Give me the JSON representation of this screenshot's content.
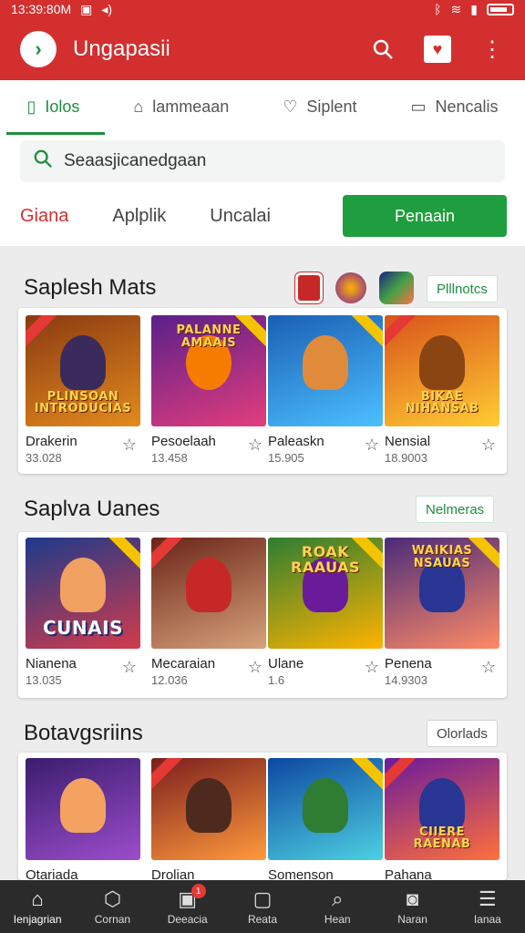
{
  "status": {
    "time": "13:39:80M",
    "left_icons": [
      "gallery-icon",
      "sound-icon"
    ],
    "right_icons": [
      "bluetooth-icon",
      "wifi-icon",
      "signal-icon",
      "battery-icon"
    ]
  },
  "appbar": {
    "title": "Ungapasii",
    "logo_glyph": "›"
  },
  "tabs": [
    {
      "label": "Iolos",
      "icon": "phone-icon",
      "glyph": "▯"
    },
    {
      "label": "lammeaan",
      "icon": "bag-icon",
      "glyph": "⌂"
    },
    {
      "label": "Siplent",
      "icon": "heart-icon",
      "glyph": "♡"
    },
    {
      "label": "Nencalis",
      "icon": "wallet-icon",
      "glyph": "▭"
    }
  ],
  "search": {
    "placeholder": "Seaasjicanedgaan"
  },
  "filters": {
    "chips": [
      "Giana",
      "Aplplik",
      "Uncalai"
    ],
    "primary_button": "Penaain"
  },
  "sections": [
    {
      "title": "Saplesh Mats",
      "more_label": "Plllnotcs",
      "apps": [
        {
          "name": "Drakerin",
          "count": "33.028",
          "caption": "PLINSOAN INTRODUCIAS",
          "bg": "#8a3a12",
          "bg2": "#e38a1c",
          "hero": "#3b2a5c"
        },
        {
          "name": "Pesoelaah",
          "count": "13.458",
          "caption": "PALANNE AMAAIS",
          "bg": "#5b1f8a",
          "bg2": "#e33d7c",
          "hero": "#f57c00"
        },
        {
          "name": "Paleaskn",
          "count": "15.905",
          "caption": "",
          "bg": "#1a5fb4",
          "bg2": "#4cc0ff",
          "hero": "#e08a3c"
        },
        {
          "name": "Nensial",
          "count": "18.9003",
          "caption": "BIKAE NIHANSAB",
          "bg": "#d9541a",
          "bg2": "#ffcc33",
          "hero": "#8b4513"
        }
      ]
    },
    {
      "title": "Saplva Uanes",
      "more_label": "Nelmeras",
      "apps": [
        {
          "name": "Nianena",
          "count": "13.035",
          "caption": "CUNAIS",
          "bg": "#1e3a8a",
          "bg2": "#d23b4b",
          "hero": "#f0a060"
        },
        {
          "name": "Mecaraian",
          "count": "12.036",
          "caption": "",
          "bg": "#6b2418",
          "bg2": "#d6a27a",
          "hero": "#c62828"
        },
        {
          "name": "Ulane",
          "count": "1.6",
          "caption": "ROAK RAAUAS",
          "bg": "#2e7d32",
          "bg2": "#ffb300",
          "hero": "#6a1b9a"
        },
        {
          "name": "Penena",
          "count": "14.9303",
          "caption": "WAIKIAS NSAUAS",
          "bg": "#4a2b7a",
          "bg2": "#ff8a65",
          "hero": "#283593"
        }
      ]
    },
    {
      "title": "Botavgsriins",
      "more_label": "Olorlads",
      "apps": [
        {
          "name": "Otariada",
          "count": "",
          "caption": "",
          "bg": "#3a1d6e",
          "bg2": "#9c4dcc",
          "hero": "#f4a261"
        },
        {
          "name": "Drolian",
          "count": "",
          "caption": "",
          "bg": "#7b1e1e",
          "bg2": "#ff9a3c",
          "hero": "#4e2a1e"
        },
        {
          "name": "Somenson",
          "count": "",
          "caption": "",
          "bg": "#0d47a1",
          "bg2": "#4dd0e1",
          "hero": "#2e7d32"
        },
        {
          "name": "Pahana",
          "count": "",
          "caption": "CIIERE RAENAB",
          "bg": "#6a1b9a",
          "bg2": "#ff6f3c",
          "hero": "#283593"
        }
      ]
    }
  ],
  "bottom_nav": [
    {
      "label": "Ienjagrian",
      "icon": "home-icon",
      "glyph": "⌂"
    },
    {
      "label": "Cornan",
      "icon": "hexagon-icon",
      "glyph": "⬡"
    },
    {
      "label": "Deeacia",
      "icon": "inbox-icon",
      "glyph": "▣",
      "badge": "1"
    },
    {
      "label": "Reata",
      "icon": "tv-icon",
      "glyph": "▢"
    },
    {
      "label": "Hean",
      "icon": "search-icon",
      "glyph": "⌕"
    },
    {
      "label": "Naran",
      "icon": "camera-icon",
      "glyph": "◙"
    },
    {
      "label": "Ianaa",
      "icon": "menu-icon",
      "glyph": "☰"
    }
  ],
  "colors": {
    "brand_red": "#d32f2f",
    "accent_green": "#1e8e3e"
  }
}
